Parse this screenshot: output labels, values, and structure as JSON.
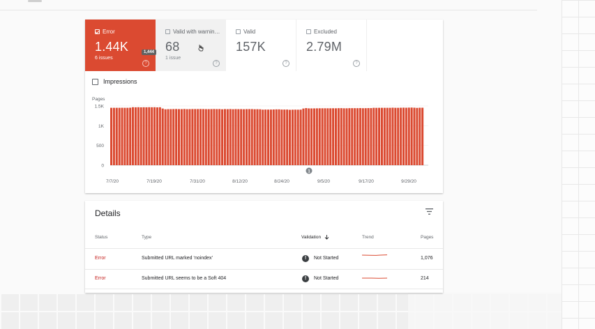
{
  "tiles": {
    "error": {
      "label": "Error",
      "value": "1.44K",
      "sub": "6 issues",
      "checked": true
    },
    "warning": {
      "label": "Valid with warnin…",
      "value": "68",
      "sub": "1 issue"
    },
    "valid": {
      "label": "Valid",
      "value": "157K"
    },
    "excluded": {
      "label": "Excluded",
      "value": "2.79M"
    }
  },
  "tooltip": "1,444",
  "impressions_label": "Impressions",
  "chart_data": {
    "type": "bar",
    "ylabel": "Pages",
    "yticks": [
      "1.5K",
      "1K",
      "500",
      "0"
    ],
    "ylim": [
      0,
      1500
    ],
    "xticks": [
      "7/7/20",
      "7/19/20",
      "7/31/20",
      "8/12/20",
      "8/24/20",
      "9/5/20",
      "9/17/20",
      "9/29/20"
    ],
    "values": [
      1453,
      1453,
      1453,
      1453,
      1454,
      1453,
      1453,
      1456,
      1468,
      1466,
      1468,
      1465,
      1467,
      1466,
      1468,
      1467,
      1468,
      1464,
      1467,
      1435,
      1416,
      1419,
      1420,
      1422,
      1423,
      1420,
      1420,
      1424,
      1419,
      1420,
      1422,
      1422,
      1422,
      1423,
      1422,
      1420,
      1419,
      1421,
      1423,
      1421,
      1422,
      1416,
      1421,
      1419,
      1422,
      1418,
      1421,
      1419,
      1420,
      1418,
      1420,
      1421,
      1421,
      1417,
      1418,
      1416,
      1407,
      1409,
      1408,
      1409,
      1411,
      1414,
      1414,
      1409,
      1409,
      1409,
      1403,
      1406,
      1407,
      1406,
      1407,
      1435,
      1446,
      1439,
      1438,
      1439,
      1440,
      1441,
      1441,
      1441,
      1441,
      1441,
      1442,
      1441,
      1444,
      1445,
      1441,
      1441,
      1444,
      1444,
      1444,
      1444,
      1446,
      1443,
      1444,
      1446,
      1446,
      1453,
      1452,
      1453,
      1453,
      1453,
      1453,
      1453,
      1456,
      1453,
      1453,
      1455,
      1457,
      1455,
      1458,
      1459,
      1456,
      1451,
      1455,
      1455
    ],
    "bar_color": "#db4a31",
    "annotation_marker": "1"
  },
  "details": {
    "title": "Details",
    "columns": {
      "status": "Status",
      "type": "Type",
      "validation": "Validation",
      "trend": "Trend",
      "pages": "Pages"
    },
    "rows": [
      {
        "status": "Error",
        "type": "Submitted URL marked ‘noindex’",
        "validation": "Not Started",
        "pages": "1,076"
      },
      {
        "status": "Error",
        "type": "Submitted URL seems to be a Soft 404",
        "validation": "Not Started",
        "pages": "214"
      }
    ]
  },
  "colors": {
    "error": "#db4a31",
    "error_text": "#c5221f"
  }
}
